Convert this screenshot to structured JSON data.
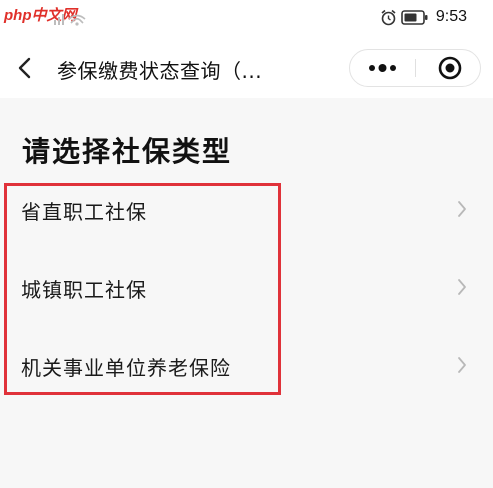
{
  "status_bar": {
    "watermark": "php中文网",
    "time": "9:53",
    "icons": [
      "signal-icon",
      "wifi-icon",
      "alarm-icon",
      "battery-icon"
    ]
  },
  "nav": {
    "title": "参保缴费状态查询（...",
    "icons": [
      "back-icon",
      "more-dots-icon",
      "close-circle-icon"
    ]
  },
  "page": {
    "heading": "请选择社保类型"
  },
  "social_insurance_types": [
    {
      "label": "省直职工社保"
    },
    {
      "label": "城镇职工社保"
    },
    {
      "label": "机关事业单位养老保险"
    }
  ],
  "colors": {
    "highlight": "#e0323a",
    "background": "#f7f7f7",
    "watermark": "#e0302a"
  }
}
